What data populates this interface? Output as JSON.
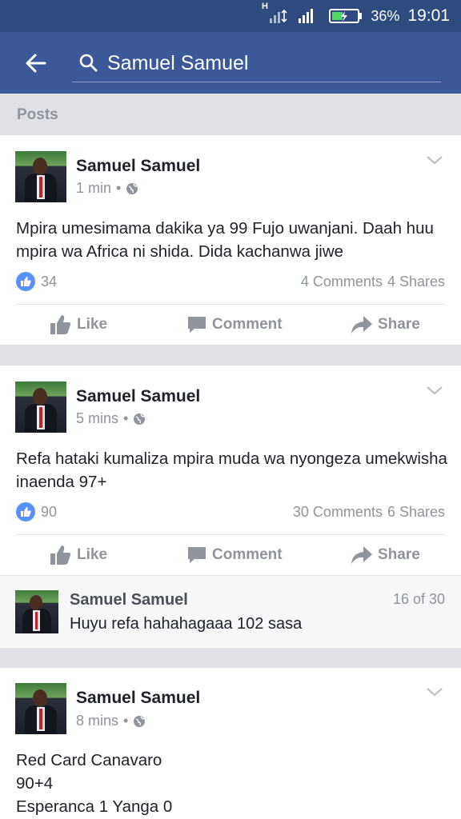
{
  "status_bar": {
    "network_type": "H",
    "battery_percent": "36%",
    "time": "19:01"
  },
  "header": {
    "search_value": "Samuel Samuel"
  },
  "section": {
    "title": "Posts"
  },
  "posts": [
    {
      "author": "Samuel Samuel",
      "time": "1 min",
      "text": "Mpira umesimama dakika ya 99 Fujo uwanjani. Daah huu mpira wa Africa ni shida. Dida kachanwa jiwe",
      "likes": "34",
      "comments": "4 Comments",
      "shares": "4 Shares"
    },
    {
      "author": "Samuel Samuel",
      "time": "5 mins",
      "text": "Refa hataki kumaliza mpira muda wa nyongeza umekwisha inaenda 97+",
      "likes": "90",
      "comments": "30 Comments",
      "shares": "6 Shares",
      "comment_preview": {
        "author": "Samuel Samuel",
        "text": "Huyu refa hahahagaaa 102 sasa",
        "position": "16 of 30"
      }
    },
    {
      "author": "Samuel Samuel",
      "time": "8 mins",
      "text_lines": [
        "Red Card Canavaro",
        "90+4",
        "Esperanca 1 Yanga 0"
      ]
    }
  ],
  "actions": {
    "like": "Like",
    "comment": "Comment",
    "share": "Share"
  },
  "meta_separator": "•",
  "colors": {
    "brand": "#3b5998",
    "status_bar": "#2f4a7f",
    "like_blue": "#5890ff",
    "battery_green": "#4cd964"
  }
}
